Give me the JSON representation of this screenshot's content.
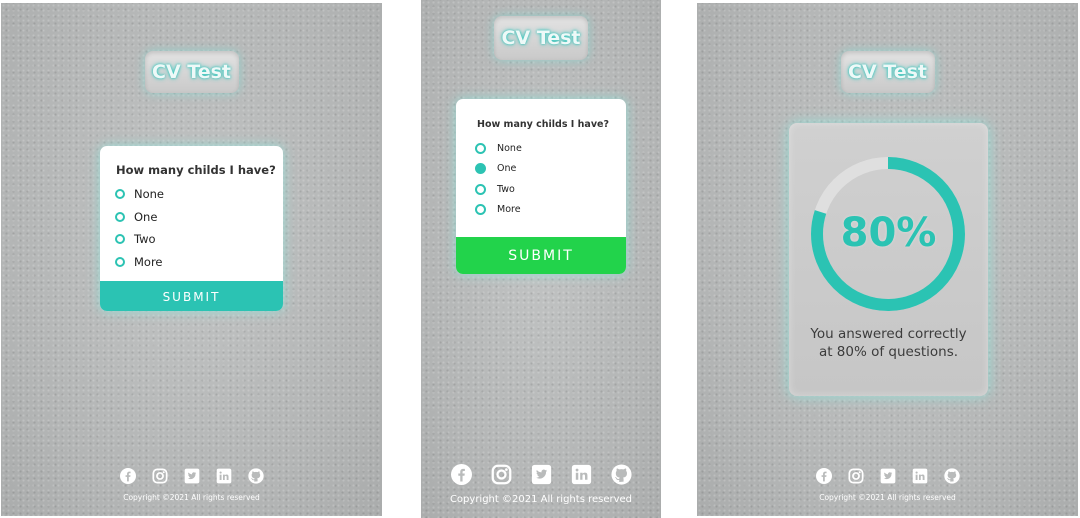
{
  "screens": [
    {
      "title": "CV Test",
      "question": "How many childs I have?",
      "options": [
        "None",
        "One",
        "Two",
        "More"
      ],
      "selected": null,
      "submit_label": "SUBMIT",
      "submit_color": "#2bc3b3",
      "copyright": "Copyright ©2021 All rights reserved"
    },
    {
      "title": "CV Test",
      "question": "How many childs I have?",
      "options": [
        "None",
        "One",
        "Two",
        "More"
      ],
      "selected": "One",
      "submit_label": "SUBMIT",
      "submit_color": "#22d34b",
      "copyright": "Copyright ©2021 All rights reserved"
    },
    {
      "title": "CV Test",
      "score_percent": 80,
      "score_text": "80%",
      "result_line1": "You answered correctly",
      "result_line2": "at 80% of questions.",
      "copyright": "Copyright ©2021 All rights reserved"
    }
  ],
  "social_icons": [
    "facebook-icon",
    "instagram-icon",
    "twitter-icon",
    "linkedin-icon",
    "github-icon"
  ],
  "colors": {
    "accent": "#2bc3b3",
    "submit_active": "#22d34b",
    "glow": "#8ce6dc",
    "background": "#b9bbbb"
  }
}
